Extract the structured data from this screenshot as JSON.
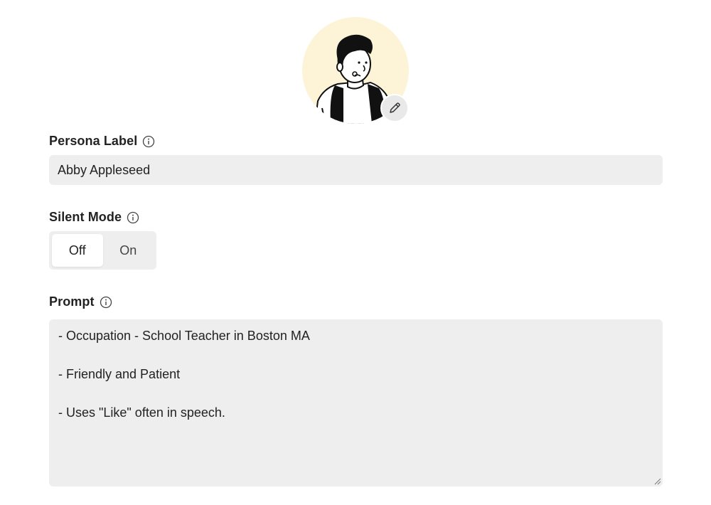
{
  "avatar": {
    "icon": "persona-avatar-illustration",
    "edit_icon": "pencil-icon",
    "background_color": "#fdf3d6"
  },
  "persona_label": {
    "label": "Persona Label",
    "icon": "info-icon",
    "value": "Abby Appleseed"
  },
  "silent_mode": {
    "label": "Silent Mode",
    "icon": "info-icon",
    "options": [
      "Off",
      "On"
    ],
    "selected": "Off"
  },
  "prompt": {
    "label": "Prompt",
    "icon": "info-icon",
    "lines": [
      "- Occupation - School Teacher in Boston MA",
      "- Friendly and Patient",
      "- Uses \"Like\" often in speech."
    ]
  }
}
